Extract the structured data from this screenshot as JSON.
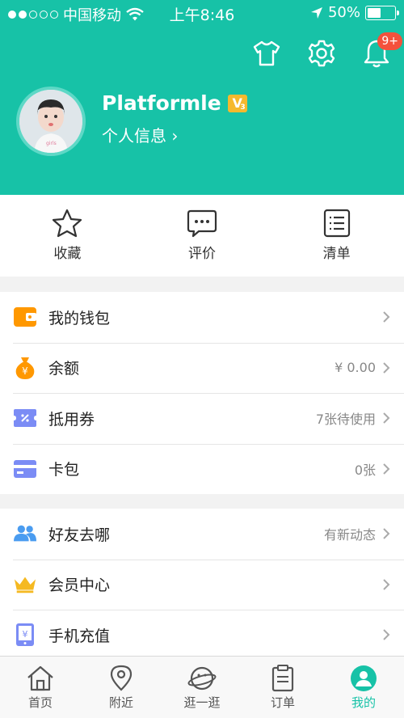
{
  "status_bar": {
    "carrier": "中国移动",
    "time": "上午8:46",
    "battery": "50%",
    "battery_level": 0.5
  },
  "header": {
    "notification_badge": "9+",
    "username": "Platformle",
    "vip_letter": "V",
    "vip_level": "3",
    "profile_link": "个人信息 ›",
    "accent_color": "#17c2a7"
  },
  "quick_actions": [
    {
      "label": "收藏",
      "icon": "star-icon"
    },
    {
      "label": "评价",
      "icon": "comment-icon"
    },
    {
      "label": "清单",
      "icon": "list-icon"
    }
  ],
  "group1": [
    {
      "label": "我的钱包",
      "value": "",
      "icon": "wallet-icon"
    },
    {
      "label": "余额",
      "value": "¥ 0.00",
      "icon": "money-bag-icon"
    },
    {
      "label": "抵用券",
      "value": "7张待使用",
      "icon": "coupon-icon"
    },
    {
      "label": "卡包",
      "value": "0张",
      "icon": "card-icon"
    }
  ],
  "group2": [
    {
      "label": "好友去哪",
      "value": "有新动态",
      "icon": "friends-icon"
    },
    {
      "label": "会员中心",
      "value": "",
      "icon": "crown-icon"
    },
    {
      "label": "手机充值",
      "value": "",
      "icon": "phone-recharge-icon"
    }
  ],
  "tabs": [
    {
      "label": "首页",
      "icon": "home-icon",
      "active": false
    },
    {
      "label": "附近",
      "icon": "location-icon",
      "active": false
    },
    {
      "label": "逛一逛",
      "icon": "planet-icon",
      "active": false
    },
    {
      "label": "订单",
      "icon": "order-icon",
      "active": false
    },
    {
      "label": "我的",
      "icon": "profile-icon",
      "active": true
    }
  ]
}
